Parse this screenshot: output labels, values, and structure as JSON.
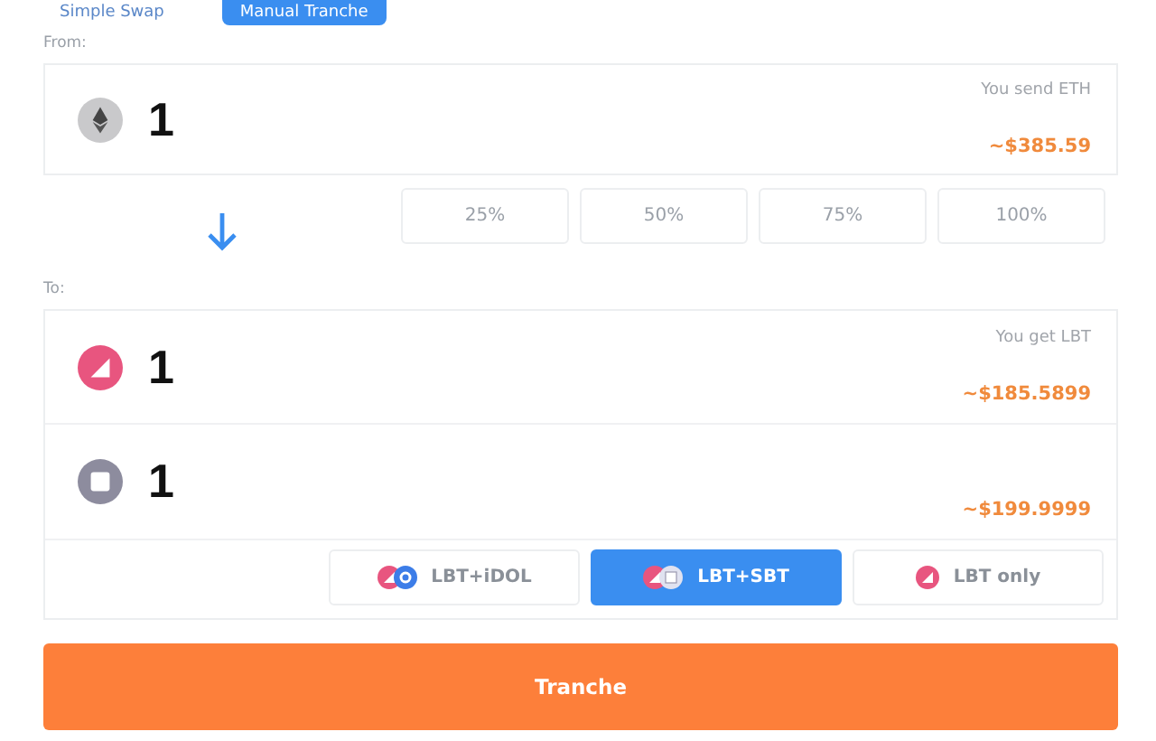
{
  "tabs": [
    {
      "label": "Simple Swap",
      "selected": false
    },
    {
      "label": "Manual Tranche",
      "selected": true
    }
  ],
  "from": {
    "label": "From:",
    "kind": "eth",
    "amount": "1",
    "caption": "You send ETH",
    "value": "~$385.59"
  },
  "percent_buttons": [
    "25%",
    "50%",
    "75%",
    "100%"
  ],
  "to": {
    "label": "To:",
    "rows": [
      {
        "kind": "lbt",
        "amount": "1",
        "caption": "You get LBT",
        "value": "~$185.5899"
      },
      {
        "kind": "sbt",
        "amount": "1",
        "value": "~$199.9999"
      }
    ]
  },
  "options": [
    {
      "label": "LBT+iDOL",
      "icons": [
        {
          "kind": "lbt"
        },
        {
          "kind": "idol"
        }
      ],
      "selected": false
    },
    {
      "label": "LBT+SBT",
      "icons": [
        {
          "kind": "lbt"
        },
        {
          "kind": "sbt"
        }
      ],
      "selected": true
    },
    {
      "label": "LBT only",
      "icons": [
        {
          "kind": "lbt"
        }
      ],
      "selected": false
    }
  ],
  "submit": "Tranche"
}
